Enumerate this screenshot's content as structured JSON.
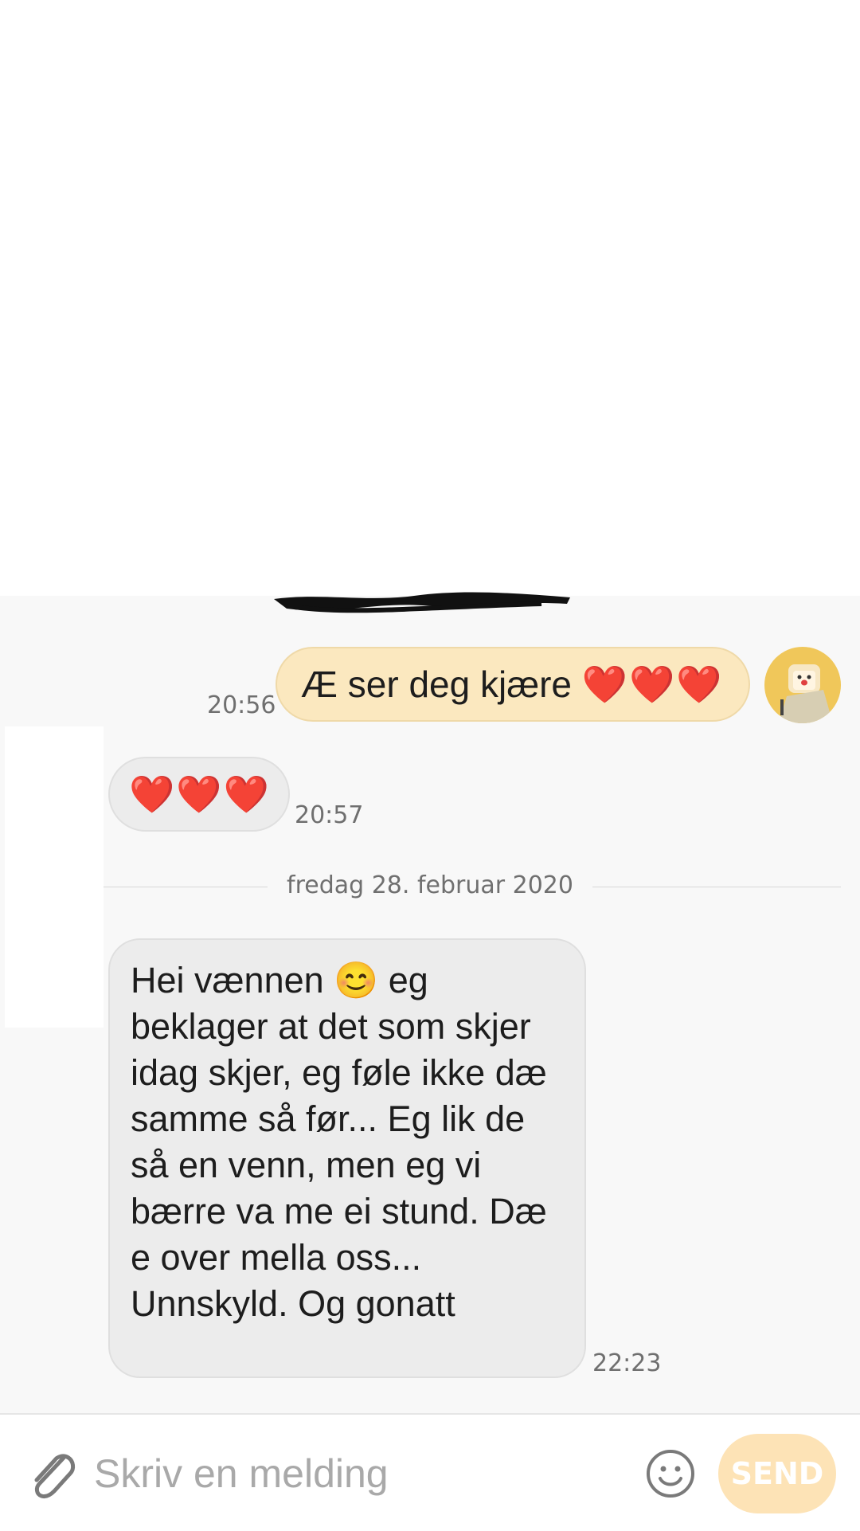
{
  "messages": [
    {
      "direction": "outgoing",
      "text": "Æ ser deg kjære",
      "emoji": "❤️❤️❤️",
      "time": "20:56"
    },
    {
      "direction": "incoming",
      "emoji": "❤️❤️❤️",
      "time": "20:57"
    },
    {
      "direction": "incoming",
      "time": "22:23",
      "text_before_emoji": "Hei vænnen ",
      "emoji": "😊",
      "text_after_emoji": " eg beklager at det som skjer idag skjer, eg føle ikke dæ samme så før... Eg lik de så en venn, men eg vi bærre va me ei stund. Dæ e over mella oss... Unnskyld. Og gonatt"
    }
  ],
  "date_divider": "fredag 28. februar 2020",
  "compose": {
    "placeholder": "Skriv en melding",
    "send_label": "SEND"
  },
  "colors": {
    "outgoing_bubble": "#fbe8bf",
    "incoming_bubble": "#ececec",
    "send_button": "#fde3b6",
    "background": "#f8f8f8"
  },
  "icons": [
    "paperclip-icon",
    "smiley-icon",
    "avatar"
  ]
}
